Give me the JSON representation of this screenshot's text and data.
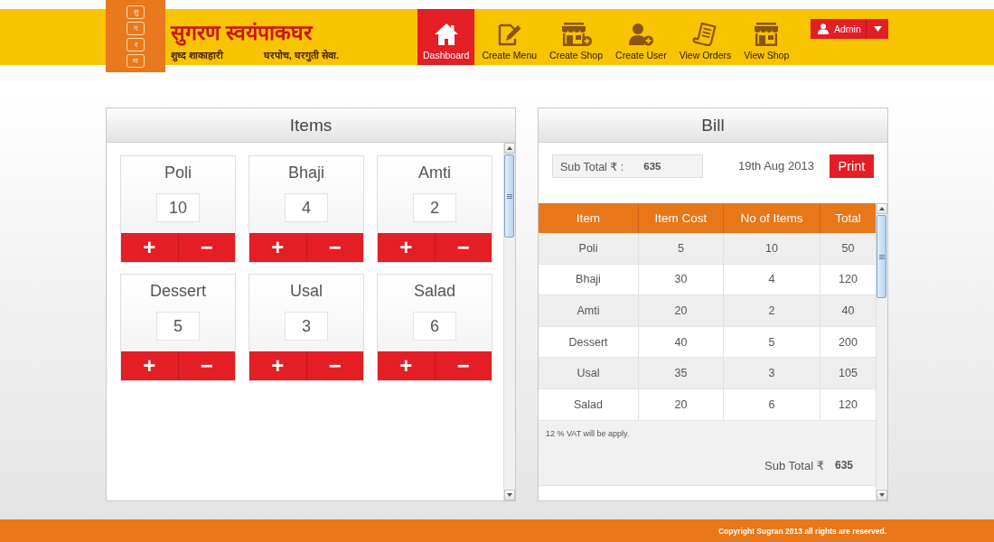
{
  "logo": {
    "letters": [
      "सु",
      "ग",
      "र",
      "ण"
    ],
    "title": "सुगरण स्वयंपाकघर",
    "tagline": "शुध्द शाकाहारी",
    "slogan": "घरपोच, घरगुती सेवा."
  },
  "nav": [
    {
      "label": "Dashboard",
      "kind": "home",
      "selected": true
    },
    {
      "label": "Create Menu",
      "kind": "compose",
      "selected": false
    },
    {
      "label": "Create Shop",
      "kind": "newshop",
      "selected": false
    },
    {
      "label": "Create User",
      "kind": "newuser",
      "selected": false
    },
    {
      "label": "View Orders",
      "kind": "orders",
      "selected": false
    },
    {
      "label": "View Shop",
      "kind": "shop",
      "selected": false
    }
  ],
  "user_menu": {
    "label": "Admin"
  },
  "items_panel": {
    "title": "Items",
    "items": [
      {
        "name": "Poli",
        "quantity": "10",
        "plus": "+",
        "minus": "−"
      },
      {
        "name": "Bhaji",
        "quantity": "4",
        "plus": "+",
        "minus": "−"
      },
      {
        "name": "Amti",
        "quantity": "2",
        "plus": "+",
        "minus": "−"
      },
      {
        "name": "Dessert",
        "quantity": "5",
        "plus": "+",
        "minus": "−"
      },
      {
        "name": "Usal",
        "quantity": "3",
        "plus": "+",
        "minus": "−"
      },
      {
        "name": "Salad",
        "quantity": "6",
        "plus": "+",
        "minus": "−"
      }
    ]
  },
  "bill_panel": {
    "title": "Bill",
    "sub_total_label": "Sub Total ₹ :",
    "sub_total": "635",
    "date": "19th Aug 2013",
    "print": "Print",
    "table": {
      "columns": [
        "Item",
        "Item Cost",
        "No of Items",
        "Total"
      ],
      "rows": [
        [
          "Poli",
          "5",
          "10",
          "50"
        ],
        [
          "Bhaji",
          "30",
          "4",
          "120"
        ],
        [
          "Amti",
          "20",
          "2",
          "40"
        ],
        [
          "Dessert",
          "40",
          "5",
          "200"
        ],
        [
          "Usal",
          "35",
          "3",
          "105"
        ],
        [
          "Salad",
          "20",
          "6",
          "120"
        ]
      ]
    },
    "note": "12 % VAT will be apply.",
    "total_label": "Sub Total ₹",
    "total": "635"
  },
  "footer": {
    "copyright": "Copyright Sugran 2013 all rights are reserved."
  }
}
